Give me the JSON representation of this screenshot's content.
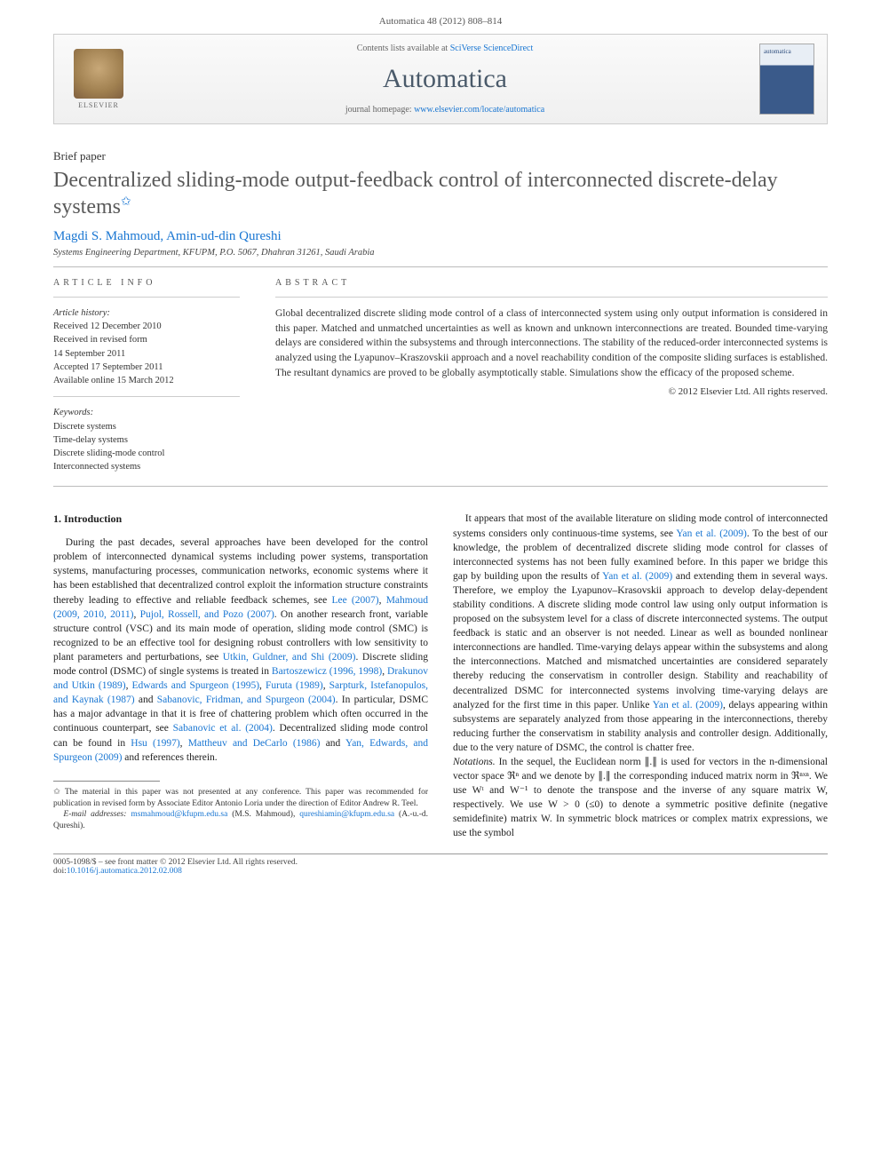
{
  "header_citation": "Automatica 48 (2012) 808–814",
  "masthead": {
    "publisher": "ELSEVIER",
    "contents_prefix": "Contents lists available at ",
    "contents_link": "SciVerse ScienceDirect",
    "journal": "Automatica",
    "homepage_prefix": "journal homepage: ",
    "homepage_link": "www.elsevier.com/locate/automatica"
  },
  "article": {
    "type": "Brief paper",
    "title": "Decentralized sliding-mode output-feedback control of interconnected discrete-delay systems",
    "title_marker": "✩",
    "authors": "Magdi S. Mahmoud, Amin-ud-din Qureshi",
    "affiliation": "Systems Engineering Department, KFUPM, P.O. 5067, Dhahran 31261, Saudi Arabia"
  },
  "info": {
    "label": "ARTICLE INFO",
    "history_label": "Article history:",
    "received": "Received 12 December 2010",
    "revised": "Received in revised form",
    "revised_date": "14 September 2011",
    "accepted": "Accepted 17 September 2011",
    "online": "Available online 15 March 2012",
    "keywords_label": "Keywords:",
    "keywords": [
      "Discrete systems",
      "Time-delay systems",
      "Discrete sliding-mode control",
      "Interconnected systems"
    ]
  },
  "abstract": {
    "label": "ABSTRACT",
    "text": "Global decentralized discrete sliding mode control of a class of interconnected system using only output information is considered in this paper. Matched and unmatched uncertainties as well as known and unknown interconnections are treated. Bounded time-varying delays are considered within the subsystems and through interconnections. The stability of the reduced-order interconnected systems is analyzed using the Lyapunov–Kraszovskii approach and a novel reachability condition of the composite sliding surfaces is established. The resultant dynamics are proved to be globally asymptotically stable. Simulations show the efficacy of the proposed scheme.",
    "copyright": "© 2012 Elsevier Ltd. All rights reserved."
  },
  "body": {
    "section1_heading": "1.  Introduction",
    "p1a": "During the past decades, several approaches have been developed for the control problem of interconnected dynamical systems including power systems, transportation systems, manufacturing processes, communication networks, economic systems where it has been established that decentralized control exploit the information structure constraints thereby leading to effective and reliable feedback schemes, see ",
    "r1": "Lee (2007)",
    "p1b": ", ",
    "r2": "Mahmoud (2009, 2010, 2011)",
    "p1c": ", ",
    "r3": "Pujol, Rossell, and Pozo (2007)",
    "p1d": ". On another research front, variable structure control (VSC) and its main mode of operation, sliding mode control (SMC) is recognized to be an effective tool for designing robust controllers with low sensitivity to plant parameters and perturbations, see ",
    "r4": "Utkin, Guldner, and Shi (2009)",
    "p1e": ". Discrete sliding mode control (DSMC) of single systems is treated in ",
    "r5": "Bartoszewicz (1996, 1998)",
    "p1f": ", ",
    "r6": "Drakunov and Utkin (1989)",
    "p1g": ", ",
    "r7": "Edwards and Spurgeon (1995)",
    "p1h": ", ",
    "r8": "Furuta (1989)",
    "p1i": ", ",
    "r9": "Sarpturk, Istefanopulos, and Kaynak (1987)",
    "p1j": " and ",
    "r10": "Sabanovic, Fridman, and Spurgeon (2004)",
    "p1k": ". In particular, DSMC has a major advantage in that it is free of chattering problem which often occurred in the continuous counterpart, see ",
    "r11": "Sabanovic et al. (2004)",
    "p1l": ". Decentralized sliding mode control can be found in ",
    "r12": "Hsu (1997)",
    "p1m": ", ",
    "r13": "Mattheuv and DeCarlo (1986)",
    "p1n": " and ",
    "r14": "Yan, Edwards, and Spurgeon (2009)",
    "p1o": " and references therein.",
    "p2a": "It appears that most of the available literature on sliding mode control of interconnected systems considers only continuous-time systems, see ",
    "r15": "Yan et al. (2009)",
    "p2b": ". To the best of our knowledge, the problem of decentralized discrete sliding mode control for classes of interconnected systems has not been fully examined before. In this paper we bridge this gap by building upon the results of ",
    "r16": "Yan et al. (2009)",
    "p2c": " and extending them in several ways. Therefore, we employ the Lyapunov–Krasovskii approach to develop delay-dependent stability conditions. A discrete sliding mode control law using only output information is proposed on the subsystem level for a class of discrete interconnected systems. The output feedback is static and an observer is not needed. Linear as well as bounded nonlinear interconnections are handled. Time-varying delays appear within the subsystems and along the interconnections. Matched and mismatched uncertainties are considered separately thereby reducing the conservatism in controller design. Stability and reachability of decentralized DSMC for interconnected systems involving time-varying delays are analyzed for the first time in this paper. Unlike ",
    "r17": "Yan et al. (2009)",
    "p2d": ", delays appearing within subsystems are separately analyzed from those appearing in the interconnections, thereby reducing further the conservatism in stability analysis and controller design. Additionally, due to the very nature of DSMC, the control is chatter free.",
    "notations_label": "Notations.",
    "notations_text": " In the sequel, the Euclidean norm ∥.∥ is used for vectors in the n-dimensional vector space ℜⁿ and we denote by ∥.∥ the corresponding induced matrix norm in ℜⁿˣⁿ. We use Wᵗ and W⁻¹ to denote the transpose and the inverse of any square matrix W, respectively. We use W > 0 (≤0) to denote a symmetric positive definite (negative semidefinite) matrix W. In symmetric block matrices or complex matrix expressions, we use the symbol"
  },
  "footnotes": {
    "star": "✩ The material in this paper was not presented at any conference. This paper was recommended for publication in revised form by Associate Editor Antonio Loria under the direction of Editor Andrew R. Teel.",
    "email_label": "E-mail addresses: ",
    "email1": "msmahmoud@kfupm.edu.sa",
    "email1_name": " (M.S. Mahmoud), ",
    "email2": "qureshiamin@kfupm.edu.sa",
    "email2_name": " (A.-u.-d. Qureshi)."
  },
  "footer": {
    "line1": "0005-1098/$ – see front matter © 2012 Elsevier Ltd. All rights reserved.",
    "doi_label": "doi:",
    "doi": "10.1016/j.automatica.2012.02.008"
  }
}
